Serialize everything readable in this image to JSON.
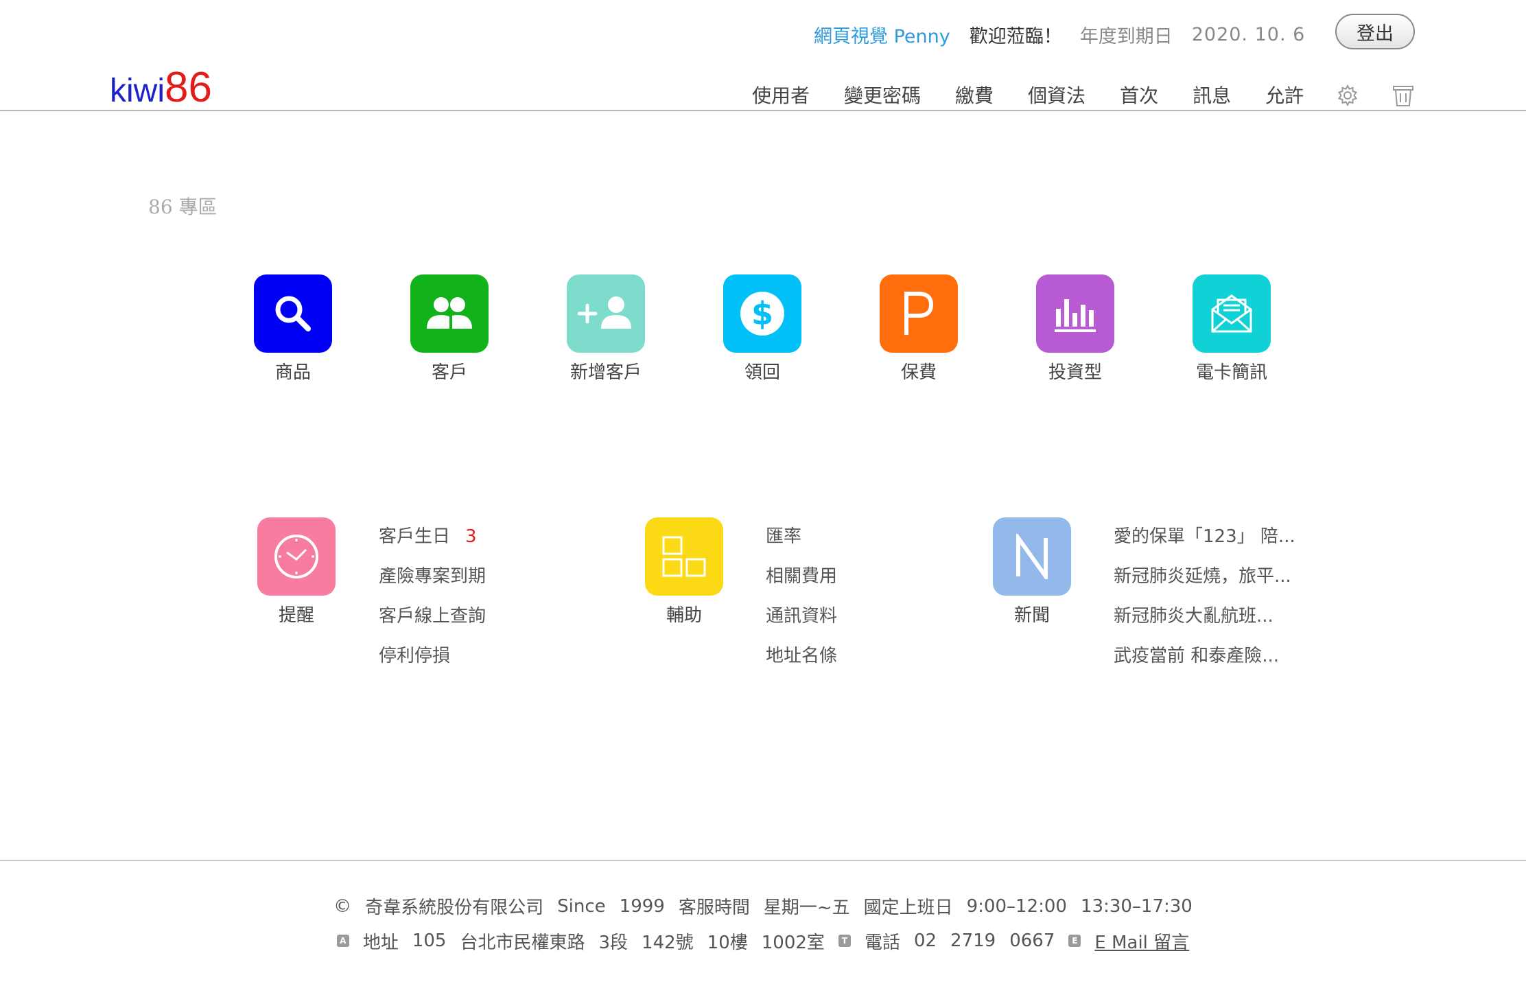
{
  "header": {
    "user_name": "網頁視覺 Penny",
    "welcome": "歡迎蒞臨！",
    "expiry_label": "年度到期日",
    "expiry_date": "2020. 10. 6",
    "logout_label": "登出",
    "logo_text": "kiwi",
    "logo_number": "86"
  },
  "nav": {
    "items": [
      "使用者",
      "變更密碼",
      "繳費",
      "個資法",
      "首次",
      "訊息",
      "允許"
    ],
    "icons": [
      "gear-icon",
      "trash-icon"
    ]
  },
  "section_title": "86 專區",
  "tiles": [
    {
      "label": "商品",
      "icon": "search-icon",
      "color": "#0000f4"
    },
    {
      "label": "客戶",
      "icon": "users-icon",
      "color": "#12b31a"
    },
    {
      "label": "新增客戶",
      "icon": "add-user-icon",
      "color": "#7ddccb"
    },
    {
      "label": "領回",
      "icon": "dollar-icon",
      "color": "#00c0f7"
    },
    {
      "label": "保費",
      "icon": "letter-p-icon",
      "color": "#ff6d0c"
    },
    {
      "label": "投資型",
      "icon": "bar-chart-icon",
      "color": "#b85ad3"
    },
    {
      "label": "電卡簡訊",
      "icon": "envelope-icon",
      "color": "#10d1d5"
    }
  ],
  "groups": [
    {
      "label": "提醒",
      "icon": "clock-icon",
      "color": "#f87ca0",
      "links": [
        "客戶生日",
        "產險專案到期",
        "客戶線上查詢",
        "停利停損"
      ],
      "badge": "3"
    },
    {
      "label": "輔助",
      "icon": "grid-icon",
      "color": "#fbd914",
      "links": [
        "匯率",
        "相關費用",
        "通訊資料",
        "地址名條"
      ]
    },
    {
      "label": "新聞",
      "icon": "letter-n-icon",
      "color": "#93b8ea",
      "links": [
        "愛的保單「123」 陪...",
        "新冠肺炎延燒，旅平...",
        "新冠肺炎大亂航班...",
        "武疫當前 和泰產險..."
      ]
    }
  ],
  "footer": {
    "copyright_symbol": "©",
    "company": "奇韋系統股份有限公司",
    "since_label": "Since",
    "since_year": "1999",
    "service_label": "客服時間",
    "days": "星期一~五",
    "workday": "國定上班日",
    "hours_am": "9:00–12:00",
    "hours_pm": "13:30–17:30",
    "address_marker": "A",
    "address_label": "地址",
    "postcode": "105",
    "street": "台北市民權東路",
    "section": "3段",
    "number": "142號",
    "floor": "10樓",
    "room": "1002室",
    "phone_marker": "T",
    "phone_label": "電話",
    "phone_area": "02",
    "phone_prefix": "2719",
    "phone_suffix": "0667",
    "email_marker": "E",
    "email_label": "E Mail 留言"
  }
}
